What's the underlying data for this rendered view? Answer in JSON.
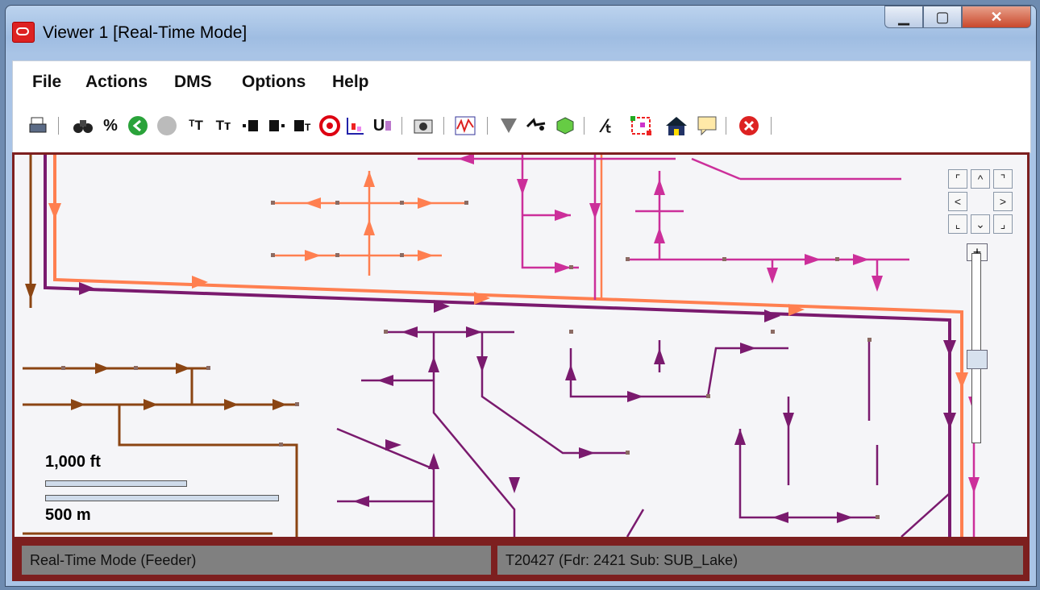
{
  "window": {
    "title": "Viewer 1 [Real-Time Mode]"
  },
  "menu": {
    "file": "File",
    "actions": "Actions",
    "dms": "DMS",
    "options": "Options",
    "help": "Help"
  },
  "toolbar": {
    "labels": {
      "percent": "%",
      "ut": "U"
    }
  },
  "scale": {
    "feet": "1,000 ft",
    "meters": "500 m"
  },
  "status": {
    "left": "Real-Time Mode (Feeder)",
    "right": "T20427 (Fdr: 2421 Sub: SUB_Lake)"
  },
  "colors": {
    "map_frame": "#7d1f1f",
    "orange_feeder": "#ff7f50",
    "purple_feeder": "#7a1a6e",
    "magenta_feeder": "#cc2f9a",
    "brown_feeder": "#8b4513",
    "status_bg": "#808080"
  },
  "icons": [
    "print-icon",
    "binoculars-icon",
    "percent-icon",
    "back-icon",
    "forward-icon",
    "text-size-up-icon",
    "text-size-down-icon",
    "align-left-icon",
    "align-center-icon",
    "align-right-icon",
    "target-icon",
    "chart-icon",
    "ut-icon",
    "camera-icon",
    "waveform-icon",
    "filter-icon",
    "trace-icon",
    "cube-icon",
    "switch-icon",
    "network-icon",
    "house-icon",
    "comment-icon",
    "stop-icon"
  ]
}
